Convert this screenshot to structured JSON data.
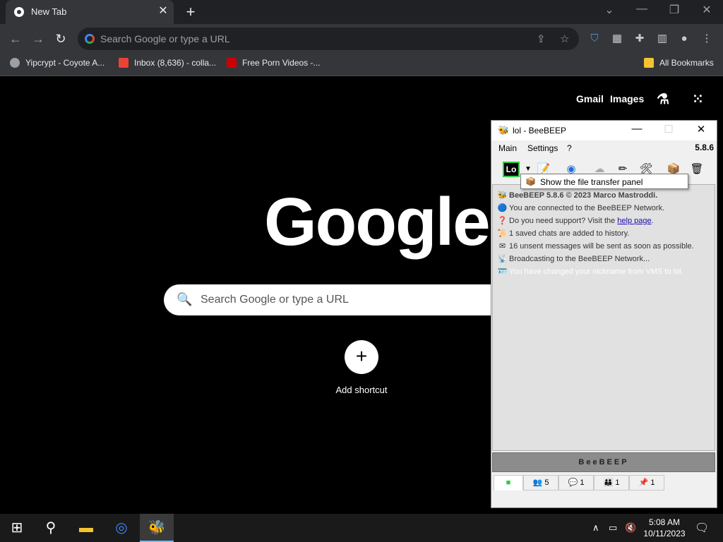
{
  "browser": {
    "tab_title": "New Tab",
    "omnibox_placeholder": "Search Google or type a URL",
    "bookmarks": [
      {
        "label": "Yipcrypt - Coyote A..."
      },
      {
        "label": "Inbox (8,636) - colla..."
      },
      {
        "label": "Free Porn Videos -..."
      }
    ],
    "all_bookmarks": "All Bookmarks"
  },
  "ntp": {
    "gmail": "Gmail",
    "images": "Images",
    "logo": "Google",
    "search_placeholder": "Search Google or type a URL",
    "add_shortcut": "Add shortcut"
  },
  "beebeep": {
    "title": "lol - BeeBEEP",
    "menu": {
      "main": "Main",
      "settings": "Settings",
      "help": "?"
    },
    "version": "5.8.6",
    "user_badge": "Lo",
    "tooltip": "Show the file transfer panel",
    "messages": [
      {
        "text": "BeeBEEP 5.8.6 © 2023 Marco Mastroddi."
      },
      {
        "text": "You are connected to the BeeBEEP Network."
      },
      {
        "text": "Do you need support? Visit the",
        "link": "help page",
        "suffix": "."
      },
      {
        "text": "1 saved chats are added to history."
      },
      {
        "text": "16 unsent messages will be sent as soon as possible."
      },
      {
        "text": "Broadcasting to the BeeBEEP Network..."
      },
      {
        "text": "You have changed your nickname from VMS to lol."
      }
    ],
    "banner": "BeeBEEP",
    "tab_counts": {
      "users": "5",
      "chats": "1",
      "groups": "1",
      "shares": "1"
    }
  },
  "taskbar": {
    "time": "5:08 AM",
    "date": "10/11/2023"
  }
}
